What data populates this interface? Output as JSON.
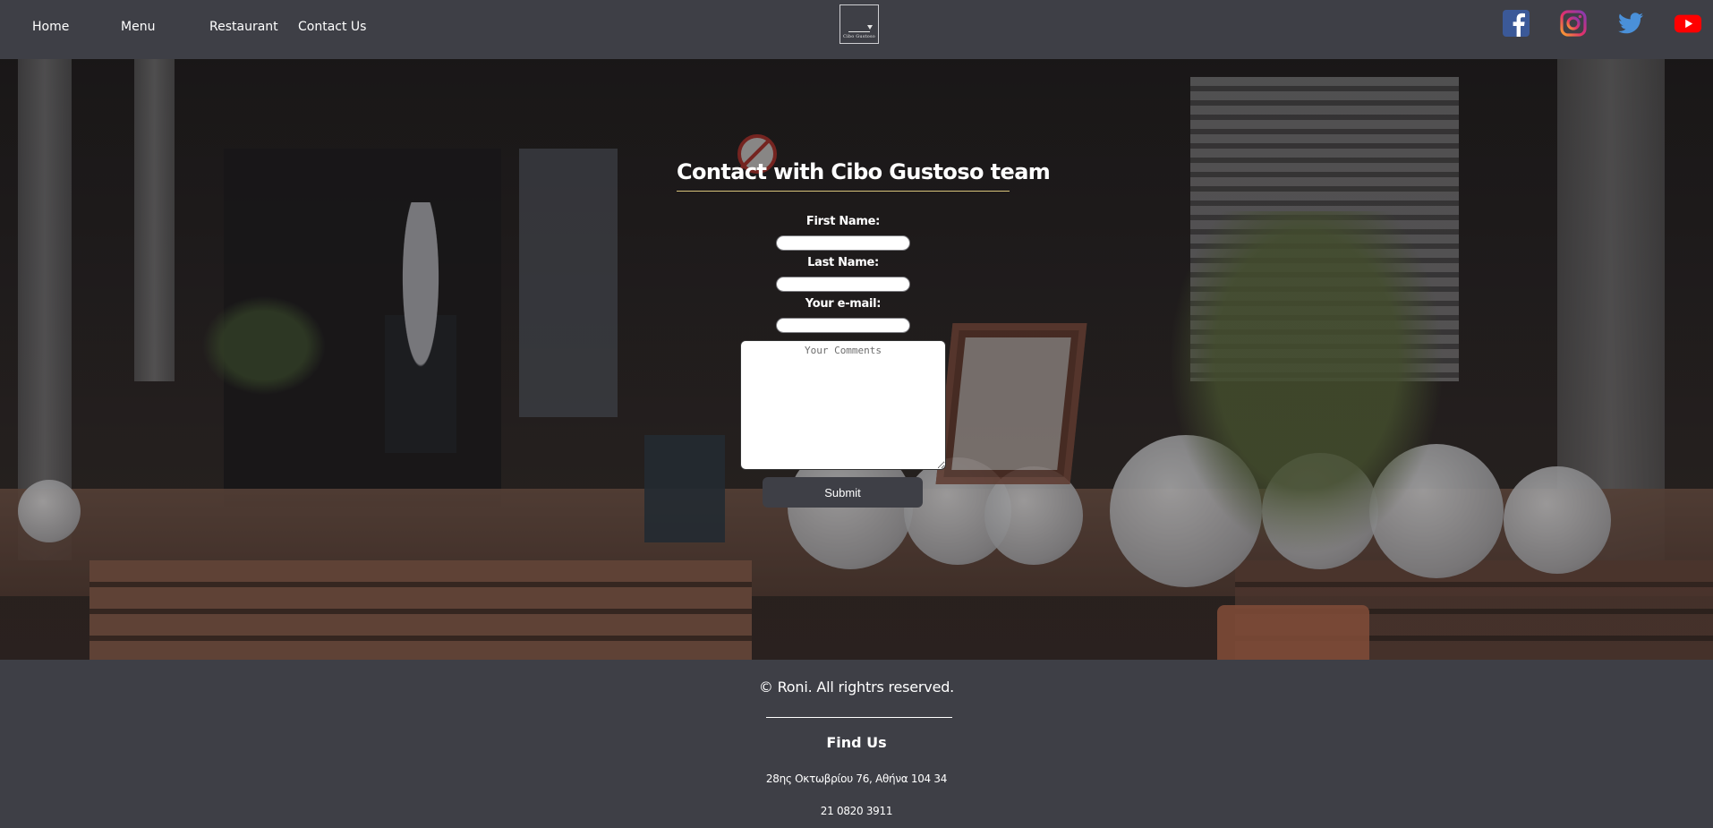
{
  "nav": {
    "links": [
      {
        "label": "Home"
      },
      {
        "label": "Menu"
      },
      {
        "label": "Restaurant"
      },
      {
        "label": "Contact Us"
      }
    ],
    "logo_text": "Cibo Gustoso"
  },
  "social": [
    {
      "icon": "facebook-icon",
      "color": "#3b5998"
    },
    {
      "icon": "instagram-icon",
      "color": "#c13584"
    },
    {
      "icon": "twitter-icon",
      "color": "#4a90d9"
    },
    {
      "icon": "youtube-icon",
      "color": "#ff0000"
    }
  ],
  "contact": {
    "title": "Contact with Cibo Gustoso team",
    "first_name_label": "First Name:",
    "last_name_label": "Last Name:",
    "email_label": "Your e-mail:",
    "comments_placeholder": "Your Comments",
    "submit_label": "Submit"
  },
  "footer": {
    "copyright": "© Roni. All rightrs reserved.",
    "find_us": "Find Us",
    "address": "28ης Οκτωβρίου 76, Αθήνα 104 34",
    "phone": "21 0820 3911"
  },
  "colors": {
    "nav_bg": "#3e3f46",
    "title_underline": "#d7c37a"
  }
}
